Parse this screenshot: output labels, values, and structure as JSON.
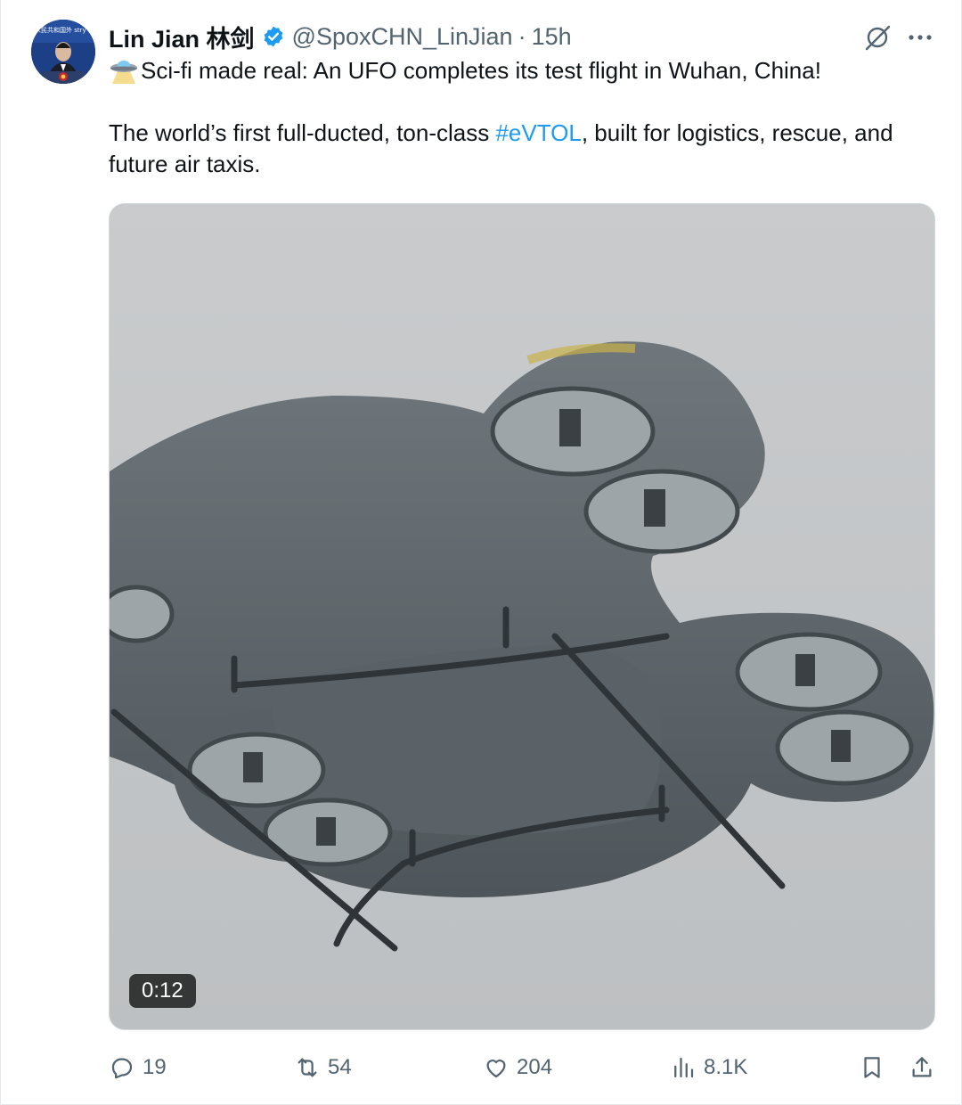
{
  "tweet": {
    "author_name": "Lin Jian 林剑",
    "handle": "@SpoxCHN_LinJian",
    "separator": "·",
    "time": "15h",
    "text_line1": "Sci-fi made real: An UFO completes its test flight in Wuhan, China!",
    "text_line2_before": "The world’s first full-ducted, ton-class ",
    "hashtag": "#eVTOL",
    "text_line2_after": ", built for logistics, rescue, and future air taxis.",
    "avatar_text": "人民共和国外 stry of Foreign A"
  },
  "media": {
    "duration": "0:12"
  },
  "actions": {
    "replies": "19",
    "reposts": "54",
    "likes": "204",
    "views": "8.1K"
  },
  "colors": {
    "accent": "#1d9bf0",
    "secondary_text": "#536471"
  },
  "icons": [
    "verified-badge-icon",
    "grok-icon",
    "more-icon",
    "ufo-emoji-icon",
    "reply-icon",
    "repost-icon",
    "like-icon",
    "views-icon",
    "bookmark-icon",
    "share-icon"
  ]
}
